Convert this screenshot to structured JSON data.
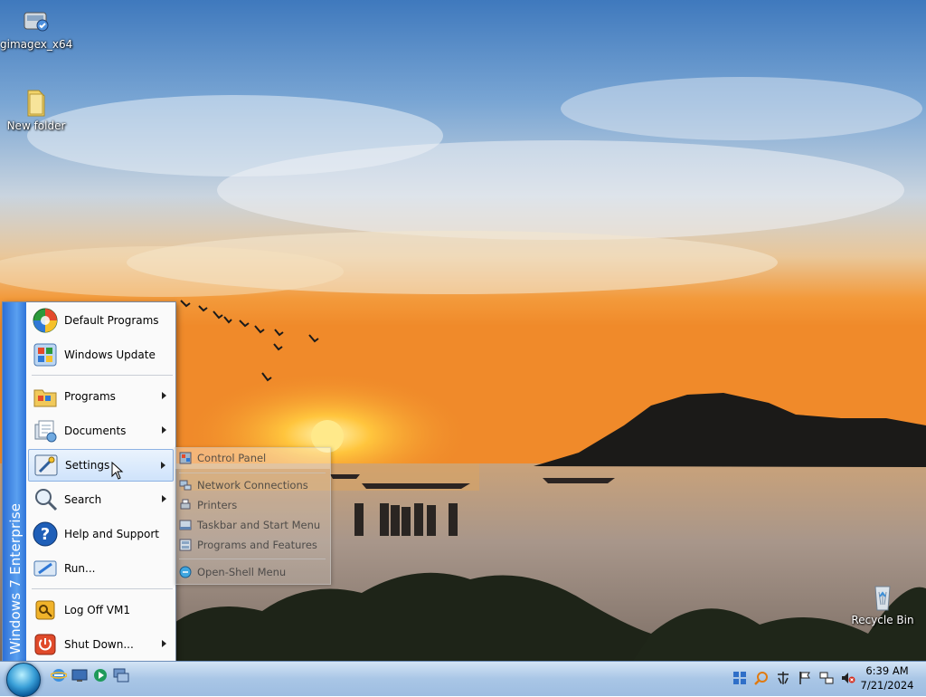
{
  "desktop": {
    "icons": [
      {
        "label": "gimagex_x64",
        "icon": "disk-tool-icon"
      },
      {
        "label": "New folder",
        "icon": "folder-icon"
      },
      {
        "label": "Recycle Bin",
        "icon": "recycle-bin-icon"
      }
    ]
  },
  "start_menu": {
    "banner": "Windows 7 Enterprise",
    "items": [
      {
        "label": "Default Programs",
        "icon": "default-programs-icon",
        "submenu": false
      },
      {
        "label": "Windows Update",
        "icon": "windows-update-icon",
        "submenu": false
      },
      {
        "label": "Programs",
        "icon": "programs-icon",
        "submenu": true
      },
      {
        "label": "Documents",
        "icon": "documents-icon",
        "submenu": true
      },
      {
        "label": "Settings",
        "icon": "settings-icon",
        "submenu": true,
        "selected": true
      },
      {
        "label": "Search",
        "icon": "search-icon",
        "submenu": true
      },
      {
        "label": "Help and Support",
        "icon": "help-icon",
        "submenu": false
      },
      {
        "label": "Run...",
        "icon": "run-icon",
        "submenu": false
      },
      {
        "label": "Log Off VM1",
        "icon": "log-off-icon",
        "submenu": false
      },
      {
        "label": "Shut Down...",
        "icon": "shut-down-icon",
        "submenu": true
      }
    ]
  },
  "settings_submenu": {
    "items": [
      {
        "label": "Control Panel",
        "icon": "control-panel-icon"
      },
      {
        "label": "Network Connections",
        "icon": "network-icon"
      },
      {
        "label": "Printers",
        "icon": "printer-icon"
      },
      {
        "label": "Taskbar and Start Menu",
        "icon": "taskbar-icon"
      },
      {
        "label": "Programs and Features",
        "icon": "programs-features-icon"
      },
      {
        "label": "Open-Shell Menu",
        "icon": "open-shell-icon"
      }
    ]
  },
  "taskbar": {
    "quick_launch": [
      "internet-explorer-icon",
      "show-desktop-icon",
      "media-player-icon",
      "switch-windows-icon"
    ],
    "tray": [
      "app-grid-icon",
      "search-tray-icon",
      "input-method-icon",
      "action-center-flag-icon",
      "network-tray-icon",
      "volume-muted-icon"
    ],
    "clock": {
      "time": "6:39 AM",
      "date": "7/21/2024"
    }
  },
  "colors": {
    "accent": "#2d6fd6",
    "taskbar": "#a9c6e6",
    "selection": "#cfe3fb"
  }
}
